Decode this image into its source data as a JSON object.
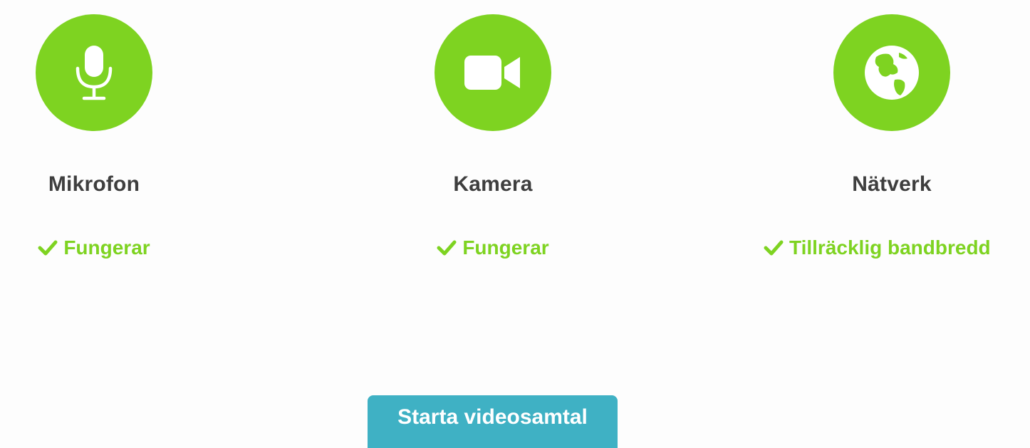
{
  "checks": [
    {
      "label": "Mikrofon",
      "status": "Fungerar",
      "icon": "microphone-icon"
    },
    {
      "label": "Kamera",
      "status": "Fungerar",
      "icon": "video-camera-icon"
    },
    {
      "label": "Nätverk",
      "status": "Tillräcklig bandbredd",
      "icon": "globe-icon"
    }
  ],
  "start_button": {
    "label": "Starta videosamtal"
  },
  "colors": {
    "accent_green": "#7ed321",
    "button_teal": "#3fb1c4",
    "label_text": "#3e3e3e",
    "background": "#fdfdfd"
  }
}
